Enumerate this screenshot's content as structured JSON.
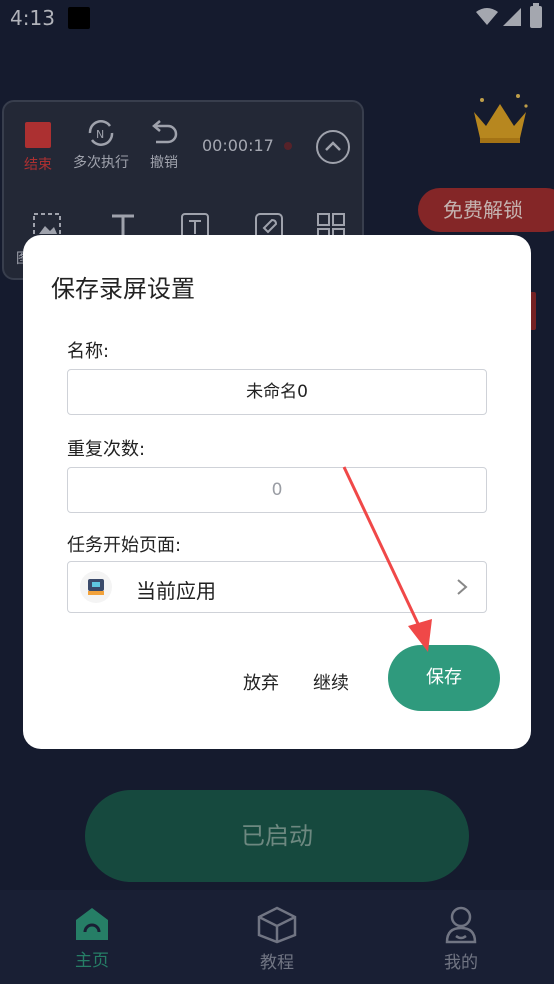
{
  "status_bar": {
    "time": "4:13"
  },
  "panel": {
    "stop_label": "结束",
    "repeat_label": "多次执行",
    "undo_label": "撤销",
    "timer": "00:00:17",
    "tool_partial_label": "图"
  },
  "promo": {
    "unlock_label": "免费解锁"
  },
  "dialog": {
    "title": "保存录屏设置",
    "name_label": "名称:",
    "name_value": "未命名0",
    "repeat_label": "重复次数:",
    "repeat_placeholder": "0",
    "start_page_label": "任务开始页面:",
    "start_page_value": "当前应用",
    "discard_label": "放弃",
    "continue_label": "继续",
    "save_label": "保存"
  },
  "main": {
    "started_label": "已启动"
  },
  "bottom_nav": {
    "items": [
      {
        "label": "主页",
        "icon": "home-icon",
        "active": true
      },
      {
        "label": "教程",
        "icon": "tutorial-icon",
        "active": false
      },
      {
        "label": "我的",
        "icon": "profile-icon",
        "active": false
      }
    ]
  },
  "colors": {
    "background": "#1a2139",
    "accent": "#2f9a7d",
    "stop_red": "#d23b3c",
    "promo_red": "#a12f30",
    "annotation_arrow": "#f04848"
  }
}
